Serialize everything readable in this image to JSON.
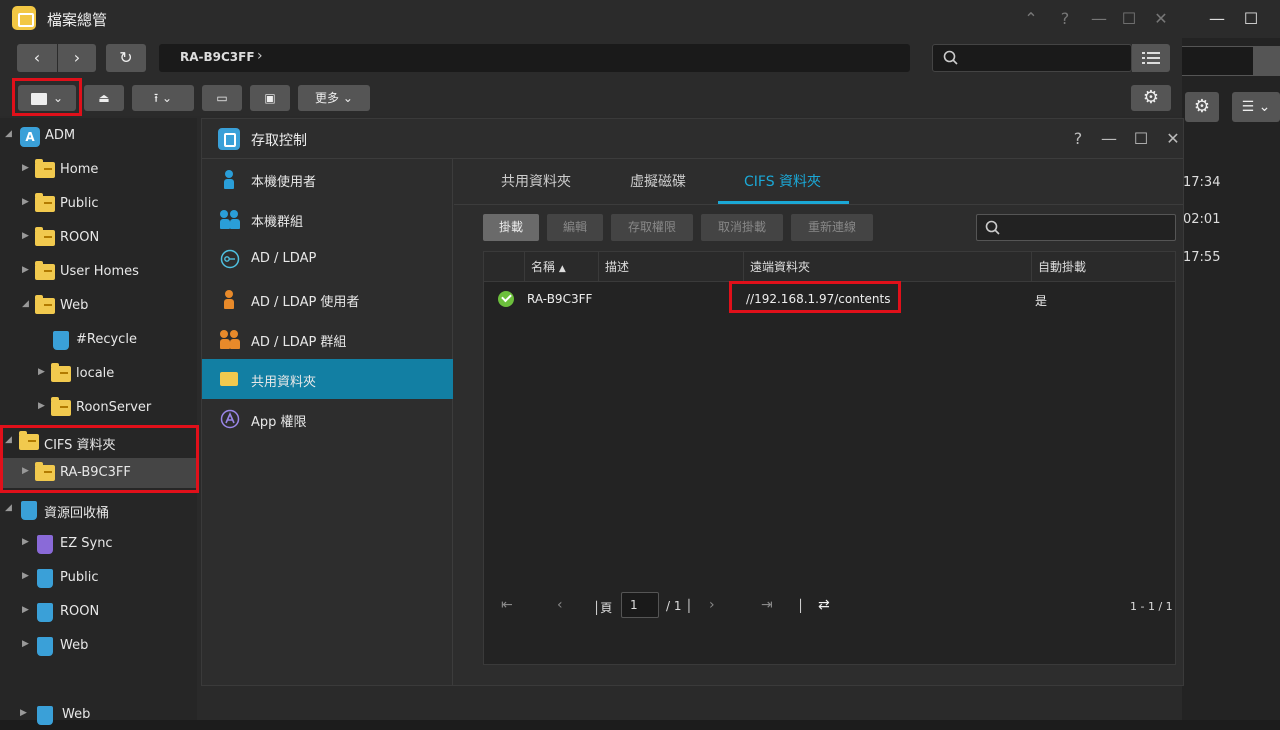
{
  "app": {
    "title": "檔案總管"
  },
  "nav": {
    "path": "RA-B9C3FF"
  },
  "toolbar": {
    "more_label": "更多"
  },
  "tree": [
    {
      "label": "ADM",
      "kind": "adm"
    },
    {
      "label": "Home",
      "kind": "folder"
    },
    {
      "label": "Public",
      "kind": "folder"
    },
    {
      "label": "ROON",
      "kind": "folder"
    },
    {
      "label": "User Homes",
      "kind": "folder"
    },
    {
      "label": "Web",
      "kind": "folder"
    },
    {
      "label": "#Recycle",
      "kind": "bin"
    },
    {
      "label": "locale",
      "kind": "folder"
    },
    {
      "label": "RoonServer",
      "kind": "folder"
    },
    {
      "label": "CIFS 資料夾",
      "kind": "folder"
    },
    {
      "label": "RA-B9C3FF",
      "kind": "network-folder"
    },
    {
      "label": "資源回收桶",
      "kind": "bin"
    },
    {
      "label": "EZ Sync",
      "kind": "bin"
    },
    {
      "label": "Public",
      "kind": "bin"
    },
    {
      "label": "ROON",
      "kind": "bin"
    },
    {
      "label": "Web",
      "kind": "bin"
    },
    {
      "label": "Web",
      "kind": "bin"
    }
  ],
  "background_window": {
    "times": [
      "17:34",
      "02:01",
      "17:55"
    ]
  },
  "dialog": {
    "title": "存取控制",
    "menu": [
      {
        "label": "本機使用者"
      },
      {
        "label": "本機群組"
      },
      {
        "label": "AD / LDAP"
      },
      {
        "label": "AD / LDAP 使用者"
      },
      {
        "label": "AD / LDAP 群組"
      },
      {
        "label": "共用資料夾"
      },
      {
        "label": "App 權限"
      }
    ],
    "tabs": [
      {
        "label": "共用資料夾"
      },
      {
        "label": "虛擬磁碟"
      },
      {
        "label": "CIFS 資料夾"
      }
    ],
    "actions": [
      {
        "label": "掛載"
      },
      {
        "label": "編輯"
      },
      {
        "label": "存取權限"
      },
      {
        "label": "取消掛載"
      },
      {
        "label": "重新連線"
      }
    ],
    "grid": {
      "columns": [
        "名稱",
        "描述",
        "遠端資料夾",
        "自動掛載"
      ],
      "rows": [
        {
          "name": "RA-B9C3FF",
          "description": "",
          "remote": "//192.168.1.97/contents",
          "automount": "是"
        }
      ]
    },
    "pager": {
      "page_label": "頁",
      "page": "1",
      "total": "/ 1",
      "range": "1 - 1 / 1"
    }
  },
  "colors": {
    "accent": "#127fa3",
    "tab_underline": "#1ba8d6",
    "highlight_box": "#e0101a"
  }
}
